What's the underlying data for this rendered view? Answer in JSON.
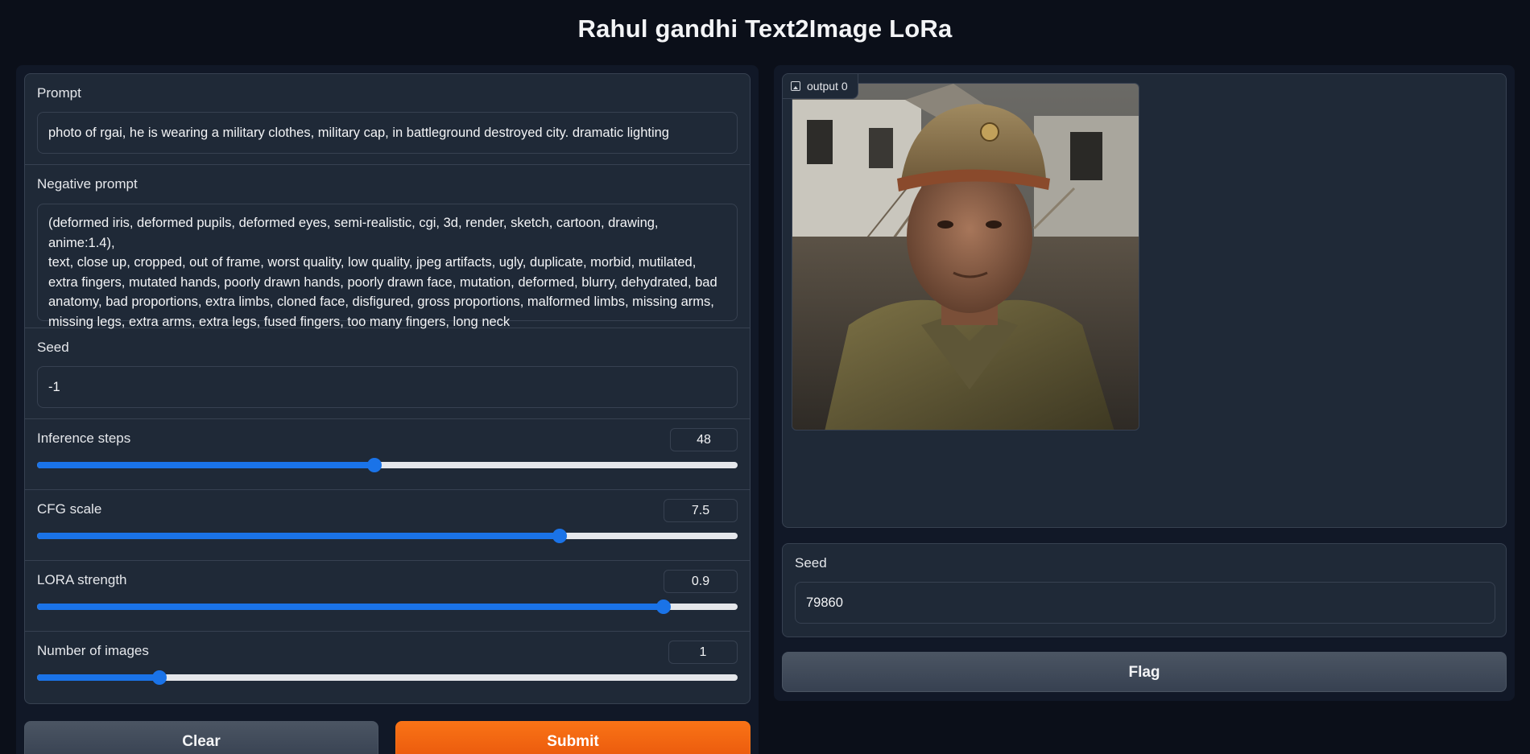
{
  "title": "Rahul gandhi Text2Image LoRa",
  "inputs": {
    "prompt_label": "Prompt",
    "prompt_value": "photo of rgai, he is wearing a military clothes, military cap, in battleground destroyed city. dramatic lighting",
    "negative_label": "Negative prompt",
    "negative_lines": [
      "(deformed iris, deformed pupils, deformed eyes, semi-realistic, cgi, 3d, render, sketch, cartoon, drawing, anime:1.4),",
      "text, close up, cropped, out of frame, worst quality, low quality, jpeg artifacts, ugly, duplicate, morbid, mutilated,",
      "extra fingers, mutated hands, poorly drawn hands, poorly drawn face, mutation, deformed, blurry, dehydrated, bad",
      "anatomy, bad proportions, extra limbs, cloned face, disfigured, gross proportions, malformed limbs, missing arms,",
      "missing legs, extra arms, extra legs, fused fingers, too many fingers, long neck"
    ],
    "seed_label": "Seed",
    "seed_value": "-1"
  },
  "sliders": [
    {
      "label": "Inference steps",
      "value": "48",
      "fraction": 0.482
    },
    {
      "label": "CFG scale",
      "value": "7.5",
      "fraction": 0.746
    },
    {
      "label": "LORA strength",
      "value": "0.9",
      "fraction": 0.894
    },
    {
      "label": "Number of images",
      "value": "1",
      "fraction": 0.175
    }
  ],
  "buttons": {
    "clear": "Clear",
    "submit": "Submit",
    "flag": "Flag"
  },
  "output": {
    "gallery_label": "output 0",
    "seed_label": "Seed",
    "seed_value": "79860"
  },
  "colors": {
    "accent": "#1a73e8",
    "primary": "#f97316",
    "background": "#0b0f19",
    "panel": "#1f2937"
  }
}
